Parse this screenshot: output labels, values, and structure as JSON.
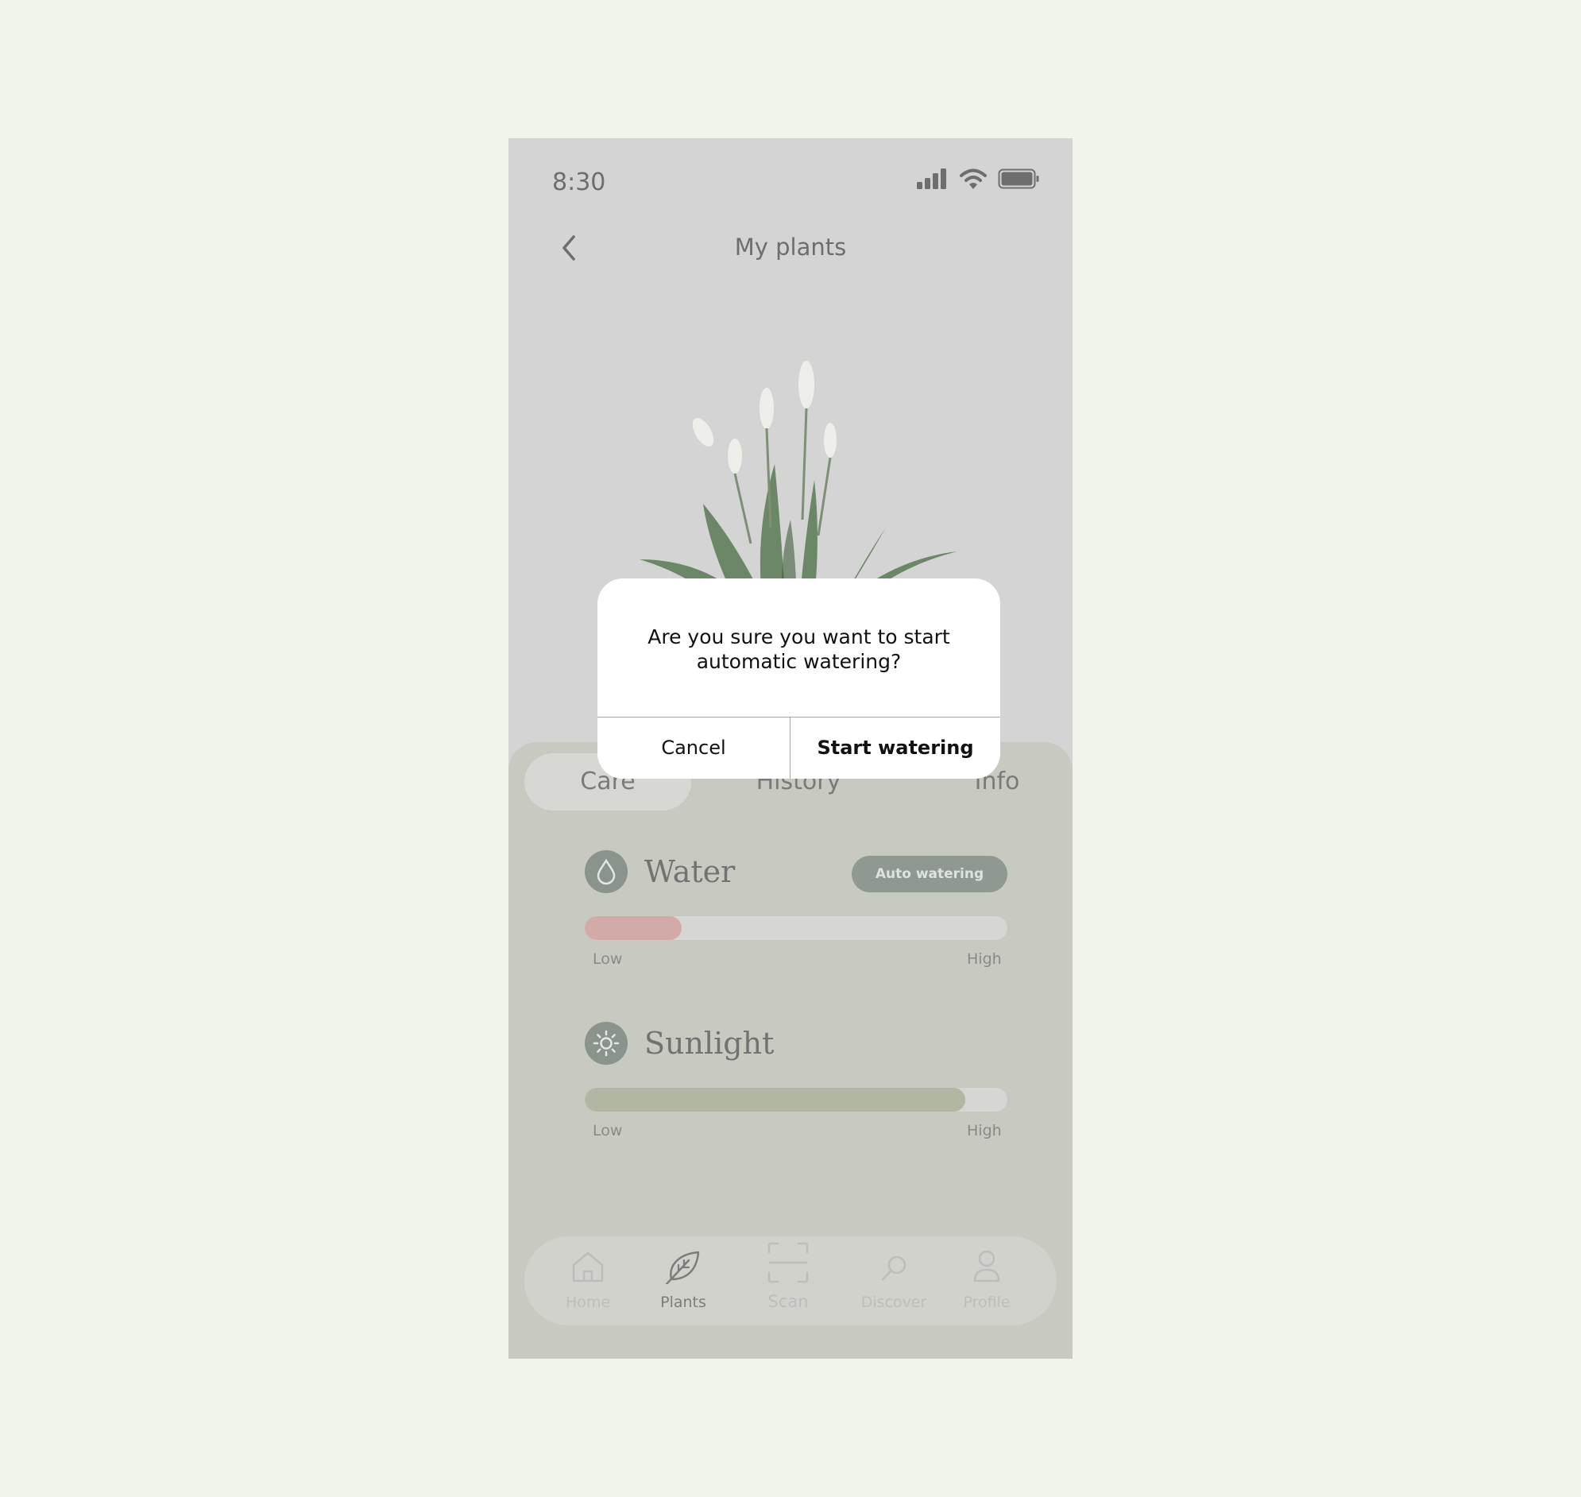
{
  "status_bar": {
    "time": "8:30"
  },
  "header": {
    "title": "My plants"
  },
  "tabs": [
    {
      "label": "Care",
      "active": true
    },
    {
      "label": "History",
      "active": false
    },
    {
      "label": "Info",
      "active": false
    }
  ],
  "metrics": {
    "water": {
      "title": "Water",
      "action_label": "Auto watering",
      "level": 0.23,
      "low_label": "Low",
      "high_label": "High",
      "fill_color": "#d4aaa9"
    },
    "sunlight": {
      "title": "Sunlight",
      "level": 0.9,
      "low_label": "Low",
      "high_label": "High",
      "fill_color": "#b2b7a3"
    }
  },
  "bottom_nav": [
    {
      "label": "Home",
      "icon": "home-icon",
      "active": false
    },
    {
      "label": "Plants",
      "icon": "leaf-icon",
      "active": true
    },
    {
      "label": "Scan",
      "icon": "scan-icon",
      "active": false
    },
    {
      "label": "Discover",
      "icon": "search-icon",
      "active": false
    },
    {
      "label": "Profile",
      "icon": "profile-icon",
      "active": false
    }
  ],
  "dialog": {
    "message": "Are you sure you want to start automatic watering?",
    "cancel_label": "Cancel",
    "confirm_label": "Start watering"
  },
  "colors": {
    "page_bg": "#f1f4ea",
    "dim_overlay": "#d4d4d4",
    "panel_bg": "#c8c9c1"
  }
}
